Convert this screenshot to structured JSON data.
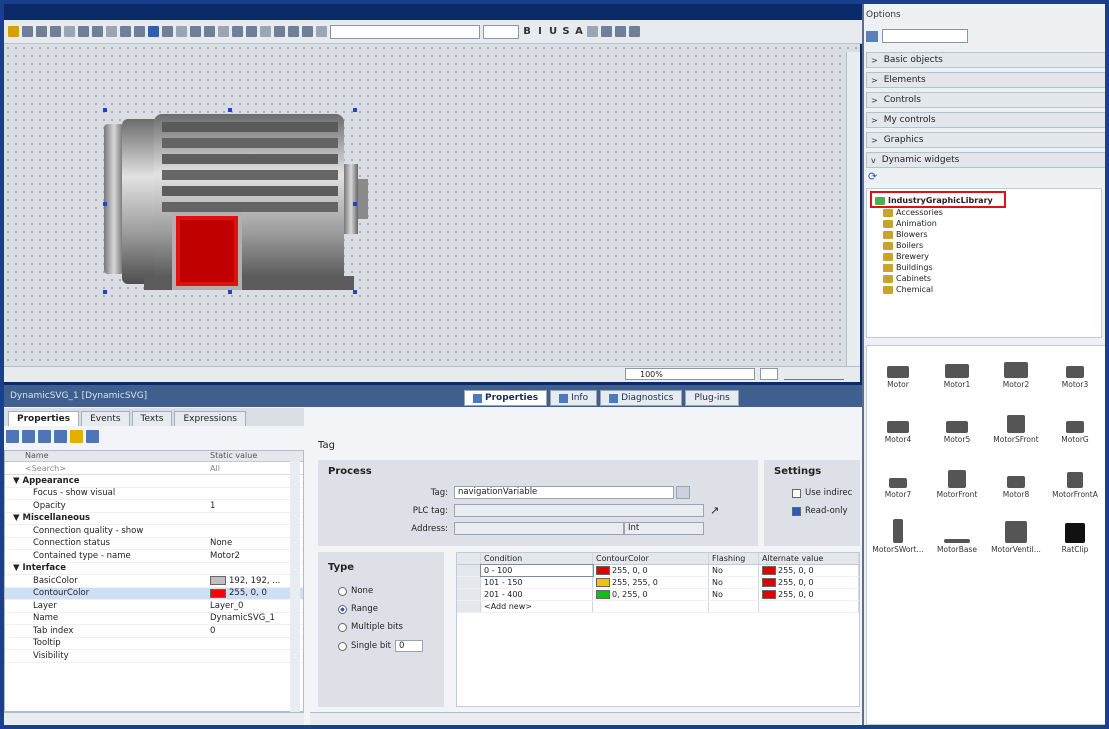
{
  "object_title": "DynamicSVG_1 [DynamicSVG]",
  "panel_tabs": [
    {
      "label": "Properties",
      "icon": "properties-icon"
    },
    {
      "label": "Info",
      "icon": "info-icon"
    },
    {
      "label": "Diagnostics",
      "icon": "diagnostics-icon"
    },
    {
      "label": "Plug-ins",
      "icon": "plugins-icon"
    }
  ],
  "sub_tabs": [
    "Properties",
    "Events",
    "Texts",
    "Expressions"
  ],
  "zoom": "100%",
  "prop_header": {
    "name": "Name",
    "value": "Static value"
  },
  "prop_search": {
    "placeholder": "<Search>",
    "all": "All"
  },
  "prop_rows": [
    {
      "name": "▼  Appearance",
      "value": "",
      "group": true
    },
    {
      "name": "Focus - show visual",
      "value": ""
    },
    {
      "name": "Opacity",
      "value": "1"
    },
    {
      "name": "▼  Miscellaneous",
      "value": "",
      "group": true
    },
    {
      "name": "Connection quality - show",
      "value": ""
    },
    {
      "name": "Connection status",
      "value": "None"
    },
    {
      "name": "Contained type - name",
      "value": "Motor2"
    },
    {
      "name": "▼  Interface",
      "value": "",
      "group": true
    },
    {
      "name": "BasicColor",
      "value": "192, 192, ...",
      "color": "#c0c0c0"
    },
    {
      "name": "ContourColor",
      "value": "255, 0, 0",
      "color": "#ff0000",
      "hl": true
    },
    {
      "name": "Layer",
      "value": "Layer_0"
    },
    {
      "name": "Name",
      "value": "DynamicSVG_1"
    },
    {
      "name": "Tab index",
      "value": "0"
    },
    {
      "name": "Tooltip",
      "value": ""
    },
    {
      "name": "Visibility",
      "value": ""
    }
  ],
  "tag_title": "Tag",
  "process": {
    "title": "Process",
    "tag_label": "Tag:",
    "tag_value": "navigationVariable",
    "plc_label": "PLC tag:",
    "addr_label": "Address:",
    "addr_type": "Int"
  },
  "settings": {
    "title": "Settings",
    "use_indirect": "Use indirec",
    "read_only": "Read-only"
  },
  "type": {
    "title": "Type",
    "none": "None",
    "range": "Range",
    "multiple": "Multiple bits",
    "single": "Single bit",
    "single_value": "0"
  },
  "grid_head": [
    "Condition",
    "ContourColor",
    "Flashing",
    "Alternate value"
  ],
  "grid_rows": [
    {
      "cond": "0 - 100",
      "color": "#e00000",
      "color_text": "255, 0, 0",
      "flash": "No",
      "alt_color": "#e00000",
      "alt_text": "255, 0, 0"
    },
    {
      "cond": "101 - 150",
      "color": "#f5c000",
      "color_text": "255, 255, 0",
      "flash": "No",
      "alt_color": "#e00000",
      "alt_text": "255, 0, 0"
    },
    {
      "cond": "201 - 400",
      "color": "#10c010",
      "color_text": "0, 255, 0",
      "flash": "No",
      "alt_color": "#e00000",
      "alt_text": "255, 0, 0"
    },
    {
      "cond": "<Add new>",
      "color": "",
      "color_text": "",
      "flash": "",
      "alt_color": "",
      "alt_text": ""
    }
  ],
  "options_title": "Options",
  "categories": [
    {
      "label": "Basic objects",
      "arrow": ">"
    },
    {
      "label": "Elements",
      "arrow": ">"
    },
    {
      "label": "Controls",
      "arrow": ">"
    },
    {
      "label": "My controls",
      "arrow": ">"
    },
    {
      "label": "Graphics",
      "arrow": ">"
    },
    {
      "label": "Dynamic widgets",
      "arrow": "v"
    }
  ],
  "library_root": "IndustryGraphicLibrary",
  "library_folders": [
    "Accessories",
    "Animation",
    "Blowers",
    "Boilers",
    "Brewery",
    "Buildings",
    "Cabinets",
    "Chemical"
  ],
  "thumbs": [
    "Motor",
    "Motor1",
    "Motor2",
    "Motor3",
    "Motor4",
    "Motor5",
    "MotorSFront",
    "MotorG",
    "Motor7",
    "MotorFront",
    "Motor8",
    "MotorFrontA",
    "MotorSWort...",
    "MotorBase",
    "MotorVentil...",
    "RatClip"
  ]
}
